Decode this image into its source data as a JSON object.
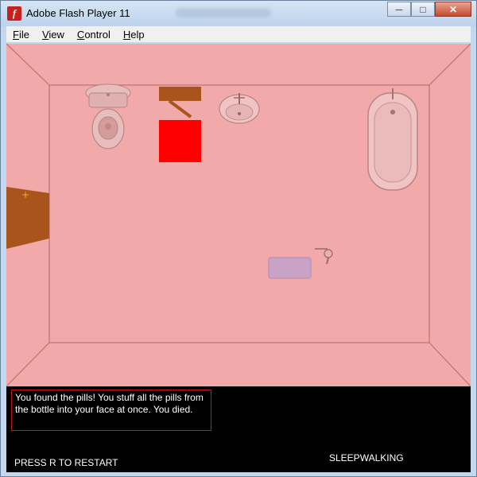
{
  "window": {
    "title": "Adobe Flash Player 11",
    "app_icon_glyph": "f",
    "minimize_glyph": "─",
    "maximize_glyph": "□",
    "close_glyph": "✕"
  },
  "menu": {
    "file": {
      "u": "F",
      "rest": "ile"
    },
    "view": {
      "u": "V",
      "rest": "iew"
    },
    "control": {
      "u": "C",
      "rest": "ontrol"
    },
    "help": {
      "u": "H",
      "rest": "elp"
    }
  },
  "stage": {
    "floor_color": "#f2a9a9",
    "line_color": "#c26f6f",
    "door_color": "#a8541c",
    "red_square_color": "#ff0000",
    "rug_color": "#c9a3c7"
  },
  "message": "You found the pills! You stuff all the pills from the bottle into your face at once. You died.",
  "restart_text": "PRESS R TO RESTART",
  "game_title": "SLEEPWALKING"
}
